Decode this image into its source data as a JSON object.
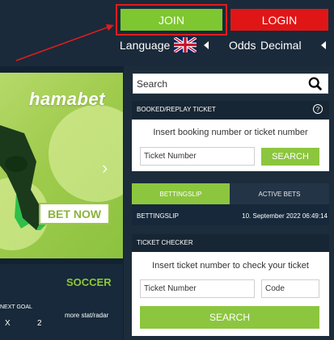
{
  "header": {
    "join_label": "JOIN",
    "login_label": "LOGIN",
    "language_label": "Language",
    "odds_label": "Odds",
    "odds_value": "Decimal"
  },
  "banner": {
    "brand": "hamabet",
    "cta": "BET NOW"
  },
  "sports": {
    "title": "SOCCER",
    "next_goal": "NEXT GOAL",
    "col_x": "X",
    "col_2": "2",
    "more": "more stat/radar"
  },
  "search": {
    "placeholder": "Search"
  },
  "booked": {
    "title": "BOOKED/REPLAY TICKET",
    "help": "?",
    "instruction": "Insert booking number or ticket number",
    "ticket_placeholder": "Ticket Number",
    "search_label": "SEARCH"
  },
  "betslip": {
    "tab_betslip": "BETTINGSLIP",
    "tab_active": "ACTIVE BETS",
    "label": "BETTINGSLIP",
    "datetime": "10. September 2022 06:49:14"
  },
  "ticket_checker": {
    "title": "TICKET CHECKER",
    "instruction": "Insert ticket number to check your ticket",
    "ticket_placeholder": "Ticket Number",
    "code_placeholder": "Code",
    "search_label": "SEARCH"
  },
  "colors": {
    "join": "#7ec730",
    "login": "#e01616",
    "accent_green": "#8cc63f",
    "highlight_red": "#e01d1d",
    "background": "#132233"
  }
}
